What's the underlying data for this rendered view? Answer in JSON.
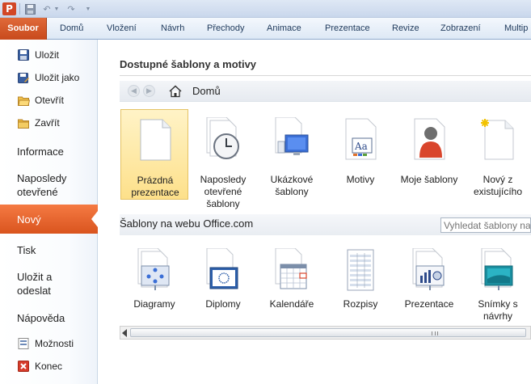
{
  "window": {
    "app_logo": "P"
  },
  "quick_access": {
    "save_icon": "save-icon",
    "undo_icon": "undo-icon",
    "redo_icon": "redo-icon"
  },
  "tabs": [
    {
      "label": "Soubor",
      "active": true
    },
    {
      "label": "Domů"
    },
    {
      "label": "Vložení"
    },
    {
      "label": "Návrh"
    },
    {
      "label": "Přechody"
    },
    {
      "label": "Animace"
    },
    {
      "label": "Prezentace"
    },
    {
      "label": "Revize"
    },
    {
      "label": "Zobrazení"
    },
    {
      "label": "Multip"
    }
  ],
  "sidebar": {
    "items": [
      {
        "label": "Uložit",
        "icon": "save-icon"
      },
      {
        "label": "Uložit jako",
        "icon": "save-as-icon"
      },
      {
        "label": "Otevřít",
        "icon": "open-folder-icon"
      },
      {
        "label": "Zavřít",
        "icon": "close-folder-icon"
      },
      {
        "label": "Informace"
      },
      {
        "label": "Naposledy otevřené"
      },
      {
        "label": "Nový",
        "active": true
      },
      {
        "label": "Tisk"
      },
      {
        "label": "Uložit a odeslat"
      },
      {
        "label": "Nápověda"
      },
      {
        "label": "Možnosti",
        "icon": "options-icon"
      },
      {
        "label": "Konec",
        "icon": "exit-icon"
      }
    ]
  },
  "main": {
    "heading": "Dostupné šablony a motivy",
    "nav": {
      "location": "Domů"
    },
    "templates": [
      {
        "label": "Prázdná prezentace",
        "icon": "blank-document-icon",
        "selected": true
      },
      {
        "label": "Naposledy otevřené šablony",
        "icon": "recent-templates-clock-icon"
      },
      {
        "label": "Ukázkové šablony",
        "icon": "sample-templates-icon"
      },
      {
        "label": "Motivy",
        "icon": "themes-icon"
      },
      {
        "label": "Moje šablony",
        "icon": "my-templates-person-icon"
      },
      {
        "label": "Nový z existujícího",
        "icon": "new-from-existing-icon"
      }
    ],
    "web": {
      "label": "Šablony na webu Office.com",
      "search_placeholder": "Vyhledat šablony na"
    },
    "web_templates": [
      {
        "label": "Diagramy",
        "icon": "diagrams-icon"
      },
      {
        "label": "Diplomy",
        "icon": "diplomas-icon"
      },
      {
        "label": "Kalendáře",
        "icon": "calendars-icon"
      },
      {
        "label": "Rozpisy",
        "icon": "schedules-icon"
      },
      {
        "label": "Prezentace",
        "icon": "presentation-chart-icon"
      },
      {
        "label": "Snímky s návrhy",
        "icon": "design-slides-icon"
      }
    ]
  },
  "colors": {
    "accent": "#d24726",
    "active_tab": "#e06a3a",
    "selected_tile": "#fde08a"
  }
}
